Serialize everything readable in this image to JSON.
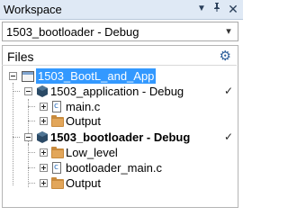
{
  "window": {
    "title": "Workspace"
  },
  "titlebar": {
    "dropdown_icon": "▼",
    "pin_icon": "📌",
    "close_icon": "✕"
  },
  "configuration": {
    "selected": "1503_bootloader - Debug",
    "arrow": "▾"
  },
  "files": {
    "header": "Files",
    "settings_icon": "⚙"
  },
  "tree": {
    "workspace": {
      "label": "1503_BootL_and_App"
    },
    "projects": [
      {
        "label": "1503_application - Debug",
        "active": false,
        "checked": true,
        "children": [
          {
            "label": "main.c",
            "type": "file"
          },
          {
            "label": "Output",
            "type": "folder"
          }
        ]
      },
      {
        "label": "1503_bootloader - Debug",
        "active": true,
        "checked": true,
        "children": [
          {
            "label": "Low_level",
            "type": "folder"
          },
          {
            "label": "bootloader_main.c",
            "type": "file"
          },
          {
            "label": "Output",
            "type": "folder"
          }
        ]
      }
    ],
    "check_mark": "✓"
  }
}
